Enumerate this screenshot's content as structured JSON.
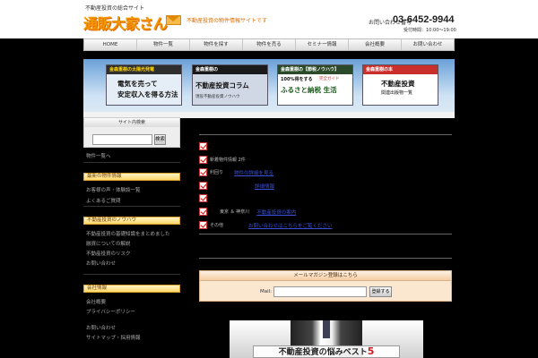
{
  "header": {
    "tagline": "不動産投資の総合サイト",
    "logo_text": "通販大家さん",
    "logo_sub": "不動産投資の物件情報サイトです",
    "contact_label": "お問い合わせ番号",
    "phone": "03-6452-9944",
    "hours": "受付時間：10:00～19:00"
  },
  "nav": {
    "items": [
      "HOME",
      "物件一覧",
      "物件を探す",
      "物件を売る",
      "セミナー情報",
      "会社概要",
      "お問い合わせ"
    ]
  },
  "banners": [
    {
      "head": "金森重樹の太陽光発電",
      "line1": "電気を売って",
      "line2": "安定収入を得る方法",
      "tag": ""
    },
    {
      "head": "金森重樹の",
      "line1": "不動産投資コラム",
      "line2": "",
      "tag": "現役不動産投資ノウハウ"
    },
    {
      "head": "金森重樹の【節税ノウハウ】",
      "line1": "100%得をする",
      "line2": "ふるさと納税 生活",
      "tag": "完全ガイド"
    },
    {
      "head": "金森重樹の本",
      "line1": "不動産投資",
      "line2": "関連出版物一覧",
      "tag": ""
    }
  ],
  "sidebar": {
    "search_title": "サイト内検索",
    "search_value": "",
    "search_button": "検索",
    "link_top": "物件一覧へ",
    "section1_head": "最新の物件情報",
    "section1_items": [
      "お客様の声・体験談一覧",
      "よくあるご質問"
    ],
    "section2_head": "不動産投資のノウハウ",
    "section2_items": [
      "不動産投資の基礎知識をまとめました",
      "融資についての解説",
      "不動産投資のリスク",
      "お問い合わせ"
    ],
    "section3_head": "会社情報",
    "section3_items": [
      "会社概要",
      "プライバシーポリシー",
      "お問い合わせ",
      "サイトマップ・採用情報"
    ]
  },
  "main": {
    "rows": [
      {
        "pre": "",
        "link": ""
      },
      {
        "pre": "新着物件情報 2件",
        "link": ""
      },
      {
        "pre": "利回り",
        "link": "物件の詳細を見る"
      },
      {
        "pre": "",
        "link": "詳細情報"
      },
      {
        "pre": "",
        "link": ""
      },
      {
        "pre": "東京 ＆ 神奈川",
        "link": "不動産投資の案内"
      },
      {
        "pre": "その他",
        "link": "お問い合わせはこちらをご覧ください"
      }
    ],
    "mail_title": "メールマガジン登録はこちら",
    "mail_label": "Mail:",
    "mail_value": "",
    "mail_button": "登録する",
    "book_title": "不動産投資の悩みベスト",
    "book_number": "5"
  }
}
